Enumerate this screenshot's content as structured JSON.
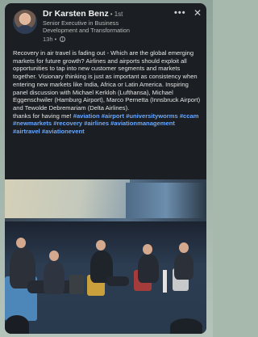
{
  "author": {
    "name": "Dr Karsten Benz",
    "degree": "• 1st",
    "headline": "Senior Executive in Business Development and Transformation",
    "age": "13h •"
  },
  "post": {
    "body": "Recovery in air travel is fading out - Which are the global emerging markets for future growth? Airlines and airports should exploit all opportunities to tap into new customer segments and markets together. Visionary thinking is just as important as consistency when entering new markets like India, Africa or Latin America. Inspiring panel discussion with Michael Kerkloh (Lufthansa), Michael Eggenschwiler (Hamburg Airport), Marco Pernetta (Innsbruck Airport) and Tewolde Debremariam (Delta Airlines).",
    "closing": "thanks for having me!",
    "hashtags": "#aviation #airport #universityworms #ccam #newmarkets #recovery #airlines #aviationmanagement #airtravel #aviationevent"
  },
  "icons": {
    "more": "•••",
    "close": "✕",
    "visibility": "globe-icon"
  },
  "colors": {
    "card_bg": "#1b1f23",
    "hashtag": "#6aa8ff",
    "text": "#e4e4e4"
  }
}
